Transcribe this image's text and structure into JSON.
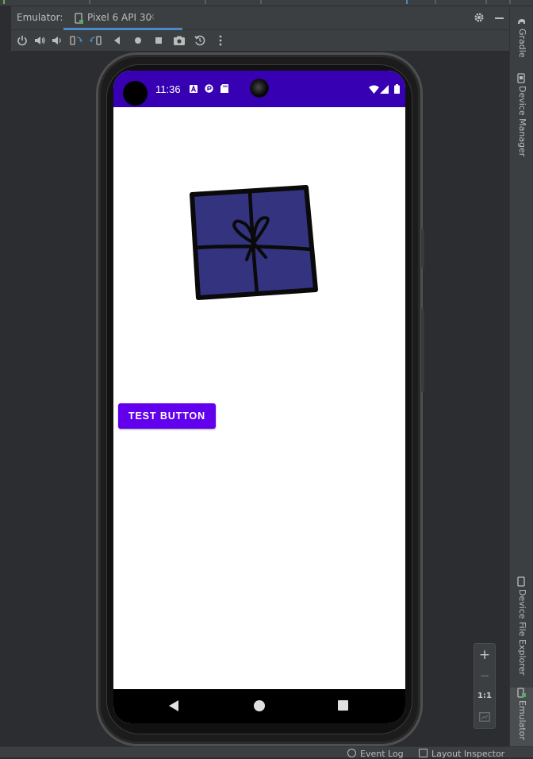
{
  "tool_window": {
    "label": "Emulator:",
    "active_tab": "Pixel 6 API 30",
    "close_glyph": "×",
    "toolbar_icons": [
      "power-icon",
      "volume-up-icon",
      "volume-down-icon",
      "rotate-left-icon",
      "rotate-right-icon",
      "back-icon",
      "home-icon",
      "overview-icon",
      "screenshot-icon",
      "snapshot-icon",
      "more-icon"
    ]
  },
  "right_sidebar": {
    "tabs": [
      "Gradle",
      "Device Manager",
      "Device File Explorer",
      "Emulator"
    ]
  },
  "bottom_bar": {
    "event_log": "Event Log",
    "layout_inspector": "Layout Inspector"
  },
  "device": {
    "status_bar": {
      "time": "11:36",
      "notification_icons": [
        "a-icon",
        "sync-icon",
        "sd-card-icon"
      ],
      "system_icons": [
        "wifi-icon",
        "signal-icon",
        "battery-icon"
      ]
    },
    "app": {
      "image": "gift-box-icon",
      "button_label": "TEST BUTTON"
    },
    "nav_bar": [
      "nav-back-icon",
      "nav-home-icon",
      "nav-recents-icon"
    ]
  },
  "zoom_controls": {
    "zoom_in": "+",
    "zoom_out": "−",
    "actual_size": "1:1"
  },
  "colors": {
    "ide_background": "#2b2d30",
    "ide_panel": "#3c3f41",
    "status_bar": "#3700b3",
    "button": "#6200ee",
    "gift_fill": "#33337f",
    "tab_underline": "#4a88c7"
  }
}
